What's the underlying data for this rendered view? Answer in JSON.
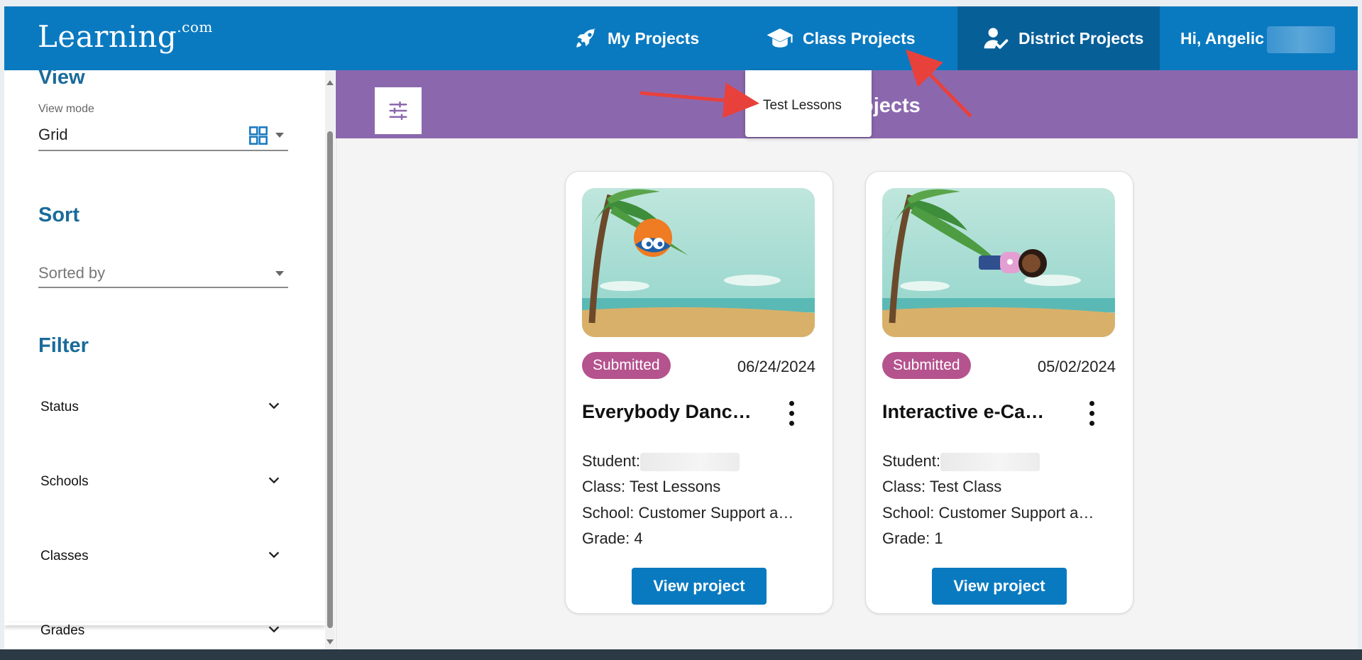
{
  "header": {
    "logo_main": "Learning",
    "logo_suffix": ".com",
    "nav": [
      {
        "label": "My Projects",
        "icon": "rocket-icon"
      },
      {
        "label": "Class Projects",
        "icon": "graduation-cap-icon"
      },
      {
        "label": "District Projects",
        "icon": "user-check-icon"
      }
    ],
    "greeting": "Hi, Angelic"
  },
  "sidebar": {
    "view_heading": "View",
    "view_mode_label": "View mode",
    "view_mode_value": "Grid",
    "sort_heading": "Sort",
    "sort_placeholder": "Sorted by",
    "filter_heading": "Filter",
    "filters": [
      "Status",
      "Schools",
      "Classes",
      "Grades"
    ]
  },
  "toolbar": {
    "title_visible": "ojects"
  },
  "dropdown": {
    "items": [
      "Test Lessons"
    ]
  },
  "cards": [
    {
      "status": "Submitted",
      "date": "06/24/2024",
      "title": "Everybody Danc…",
      "student_label": "Student:",
      "class_line": "Class: Test Lessons",
      "school_line": "School: Customer Support a…",
      "grade_line": "Grade: 4",
      "button": "View project"
    },
    {
      "status": "Submitted",
      "date": "05/02/2024",
      "title": "Interactive e-Ca…",
      "student_label": "Student:",
      "class_line": "Class: Test Class",
      "school_line": "School: Customer Support a…",
      "grade_line": "Grade: 1",
      "button": "View project"
    }
  ],
  "colors": {
    "header_blue": "#0a7ac0",
    "header_active": "#075f98",
    "toolbar_purple": "#8b68ae",
    "badge_pink": "#b5538e",
    "heading_blue": "#1a6b9a",
    "annotation_red": "#e8413c"
  }
}
